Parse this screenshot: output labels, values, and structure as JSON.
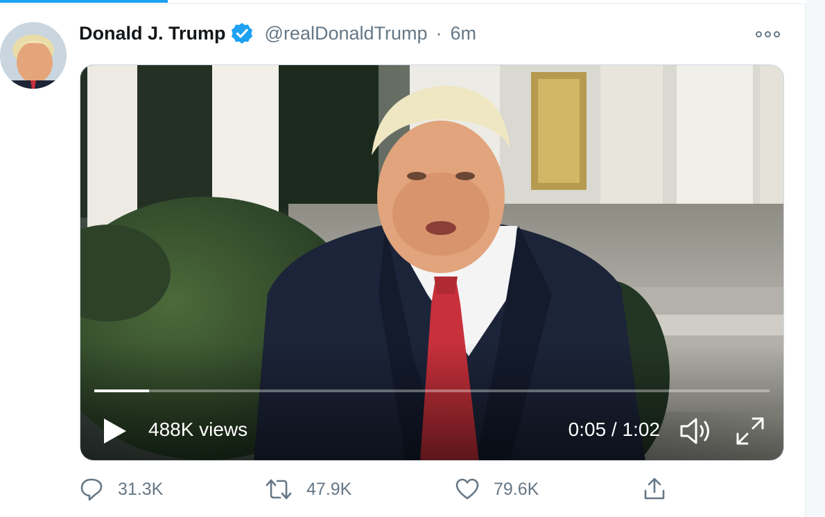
{
  "author": {
    "display_name": "Donald J. Trump",
    "handle": "@realDonaldTrump",
    "separator": "·",
    "time": "6m",
    "verified": true,
    "avatar_icon": "profile-photo"
  },
  "video": {
    "views": "488K views",
    "timecode": "0:05 / 1:02",
    "progress_fraction": 0.081,
    "controls": [
      "play-icon",
      "volume-icon",
      "fullscreen-icon"
    ]
  },
  "actions": {
    "reply_count": "31.3K",
    "retweet_count": "47.9K",
    "like_count": "79.6K"
  },
  "colors": {
    "accent": "#1da1f2",
    "muted": "#657786",
    "text": "#14171a"
  }
}
